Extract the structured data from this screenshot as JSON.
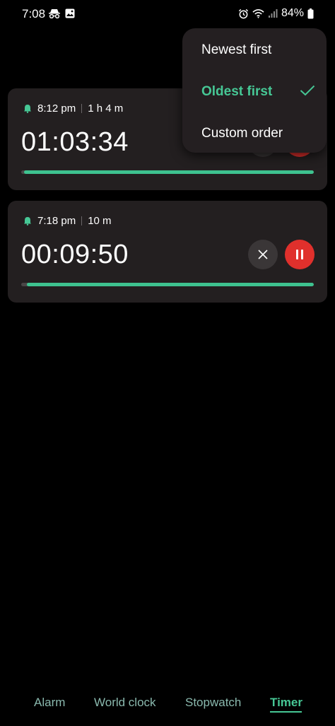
{
  "status_bar": {
    "time": "7:08",
    "battery": "84%",
    "icons": [
      "incognito-icon",
      "gallery-icon",
      "alarm-icon",
      "wifi-icon",
      "signal-icon",
      "battery-icon"
    ]
  },
  "sort_menu": {
    "items": [
      {
        "label": "Newest first",
        "selected": false
      },
      {
        "label": "Oldest first",
        "selected": true
      },
      {
        "label": "Custom order",
        "selected": false
      }
    ]
  },
  "timers": [
    {
      "end_time": "8:12 pm",
      "duration": "1 h 4 m",
      "remaining": "01:03:34",
      "progress_remaining": 0.99
    },
    {
      "end_time": "7:18 pm",
      "duration": "10 m",
      "remaining": "00:09:50",
      "progress_remaining": 0.98
    }
  ],
  "bottom_nav": {
    "tabs": [
      "Alarm",
      "World clock",
      "Stopwatch",
      "Timer"
    ],
    "active": "Timer"
  },
  "colors": {
    "accent": "#46c795",
    "pause_button": "#e0302c",
    "card_bg": "#231f20"
  }
}
